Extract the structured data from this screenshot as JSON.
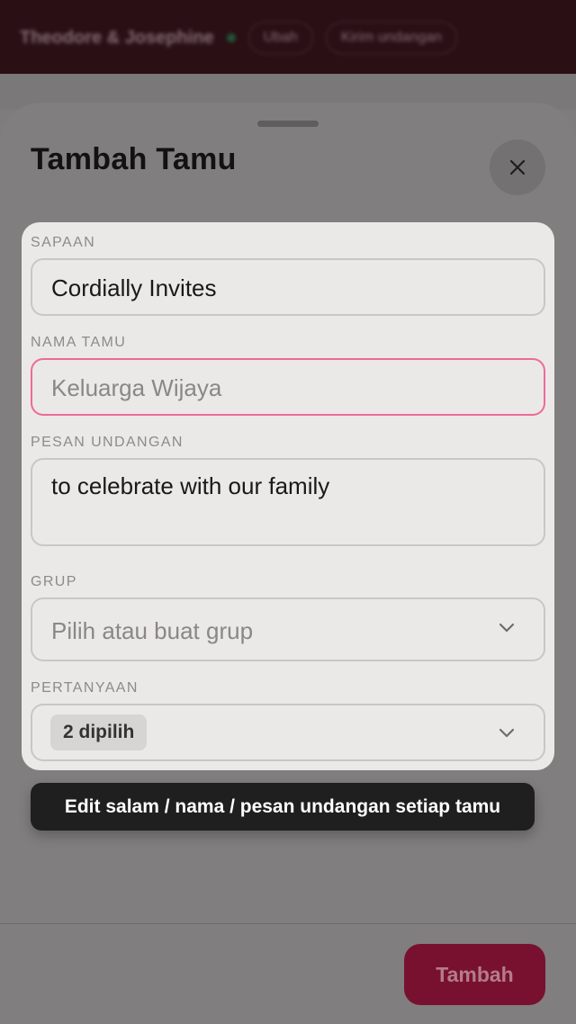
{
  "background": {
    "couple_name": "Theodore & Josephine",
    "edit_label": "Ubah",
    "invite_label": "Kirim undangan"
  },
  "sheet": {
    "title": "Tambah Tamu",
    "close_icon": "close-icon",
    "submit_label": "Tambah"
  },
  "form": {
    "greeting": {
      "label": "SAPAAN",
      "value": "Cordially Invites"
    },
    "guest_name": {
      "label": "NAMA TAMU",
      "placeholder": "Keluarga Wijaya"
    },
    "message": {
      "label": "PESAN UNDANGAN",
      "value": "to celebrate with our family"
    },
    "group": {
      "label": "GRUP",
      "placeholder": "Pilih atau buat grup"
    },
    "questions": {
      "label": "PERTANYAAN",
      "selected_chip": "2 dipilih"
    }
  },
  "tooltip": {
    "text": "Edit salam / nama / pesan undangan setiap tamu"
  },
  "colors": {
    "accent": "#78112f",
    "error_border": "#ec6b9a",
    "card_bg": "#ebe8e8",
    "tooltip_bg": "#1f1f1f"
  }
}
